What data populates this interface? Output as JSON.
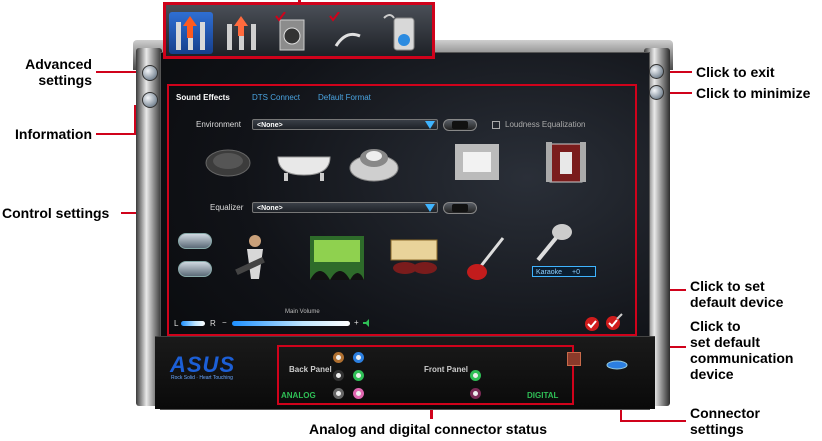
{
  "callouts": {
    "advanced_settings": "Advanced\nsettings",
    "information": "Information",
    "control_settings": "Control settings",
    "click_to_exit": "Click to exit",
    "click_to_minimize": "Click to minimize",
    "click_to_set_default_device": "Click to set\ndefault device",
    "click_to_set_default_comm": "Click to\nset default\ncommunication\ndevice",
    "connector_settings": "Connector\nsettings",
    "connector_status": "Analog and digital connector status"
  },
  "tabs": [
    "Sound Effects",
    "DTS Connect",
    "Default Format"
  ],
  "environment": {
    "label": "Environment",
    "value": "<None>",
    "loudness_label": "Loudness Equalization"
  },
  "equalizer": {
    "label": "Equalizer",
    "value": "<None>"
  },
  "karaoke": {
    "label": "Karaoke",
    "value": "+0"
  },
  "volume": {
    "label": "Main Volume",
    "left": "L",
    "right": "R",
    "minus": "−",
    "plus": "+"
  },
  "connector": {
    "back_panel": "Back Panel",
    "front_panel": "Front Panel",
    "analog": "ANALOG",
    "digital": "DIGITAL"
  },
  "brand": {
    "logo": "ASUS",
    "tagline": "Rock Solid · Heart Touching"
  },
  "colors": {
    "callout_red": "#d0021b",
    "accent_blue": "#3fb4ff",
    "digital_green": "#2fbf56"
  }
}
